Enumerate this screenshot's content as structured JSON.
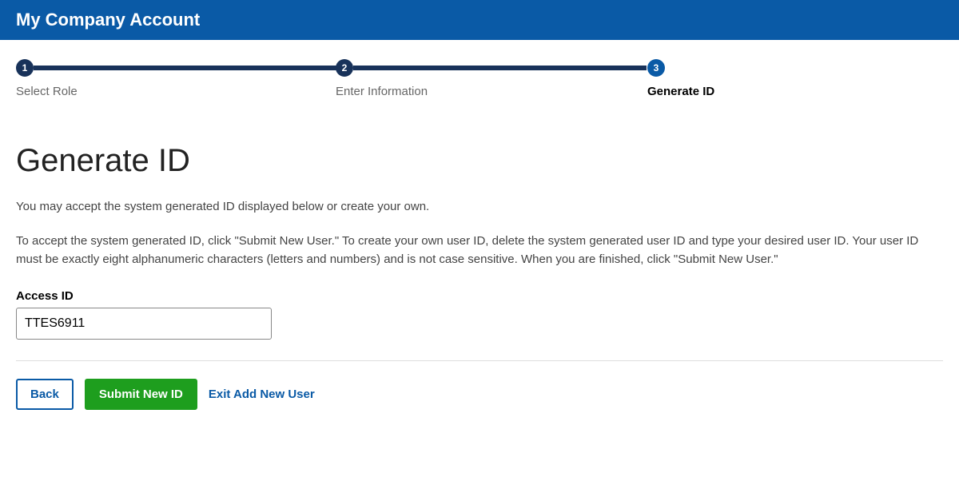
{
  "header": {
    "title": "My Company Account"
  },
  "stepper": {
    "steps": [
      {
        "num": "1",
        "label": "Select Role"
      },
      {
        "num": "2",
        "label": "Enter Information"
      },
      {
        "num": "3",
        "label": "Generate ID"
      }
    ],
    "current_index": 2
  },
  "page": {
    "title": "Generate ID",
    "intro": "You may accept the system generated ID displayed below or create your own.",
    "details": "To accept the system generated ID, click \"Submit New User.\" To create your own user ID, delete the system generated user ID and type your desired user ID. Your user ID must be exactly eight alphanumeric characters (letters and numbers) and is not case sensitive. When you are finished, click \"Submit New User.\""
  },
  "form": {
    "access_id_label": "Access ID",
    "access_id_value": "TTES6911"
  },
  "actions": {
    "back": "Back",
    "submit": "Submit New ID",
    "exit": "Exit Add New User"
  }
}
